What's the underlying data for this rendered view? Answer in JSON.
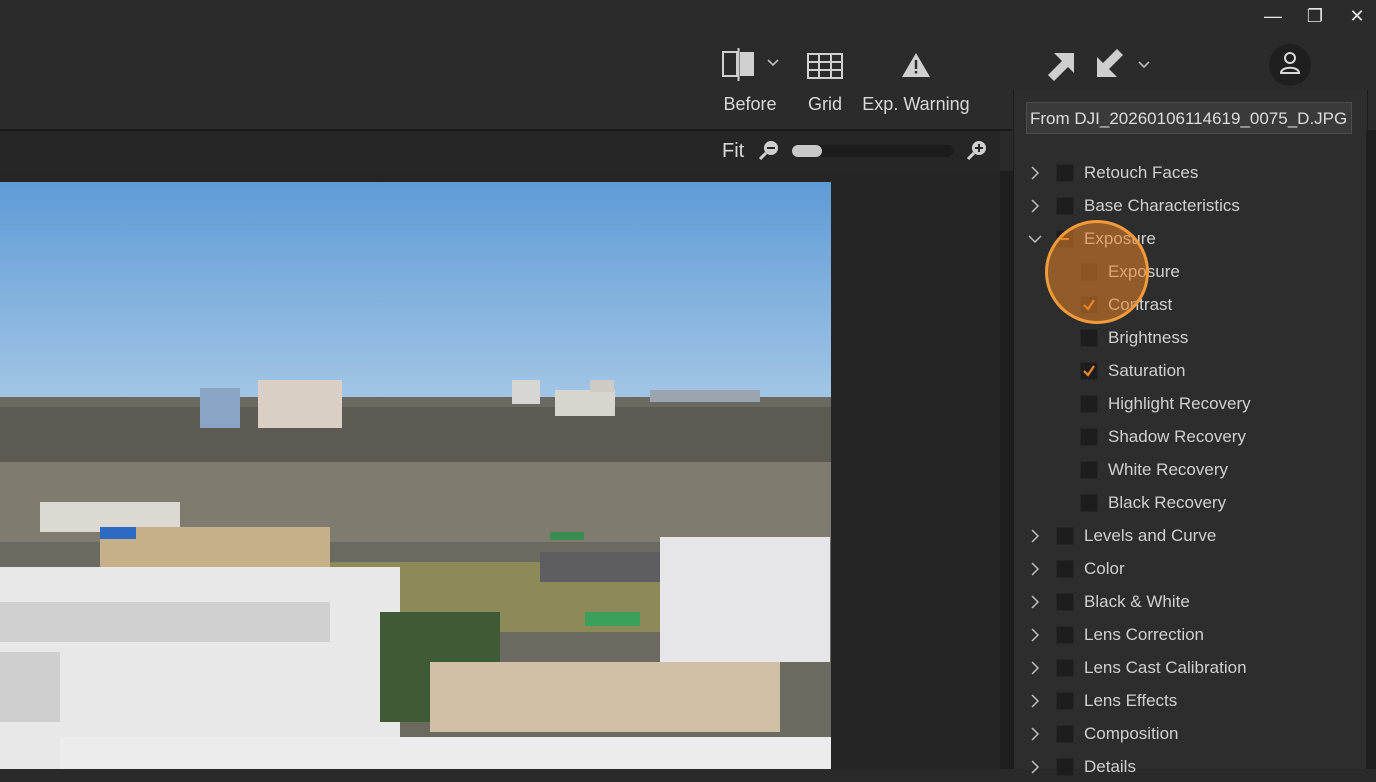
{
  "window_controls": {
    "minimize": "—",
    "maximize": "❐",
    "close": "✕"
  },
  "toolbar": {
    "before_label": "Before",
    "grid_label": "Grid",
    "exp_warning_label": "Exp. Warning"
  },
  "zoom": {
    "fit_label": "Fit",
    "level": 0.18
  },
  "panel": {
    "from_label": "From  DJI_20260106114619_0075_D.JPG",
    "items": [
      {
        "label": "Retouch Faces",
        "expanded": false,
        "checked": false,
        "level": 0
      },
      {
        "label": "Base Characteristics",
        "expanded": false,
        "checked": false,
        "level": 0
      },
      {
        "label": "Exposure",
        "expanded": true,
        "checked": "partial",
        "level": 0
      },
      {
        "label": "Exposure",
        "checked": false,
        "level": 1
      },
      {
        "label": "Contrast",
        "checked": true,
        "level": 1
      },
      {
        "label": "Brightness",
        "checked": false,
        "level": 1
      },
      {
        "label": "Saturation",
        "checked": true,
        "level": 1
      },
      {
        "label": "Highlight Recovery",
        "checked": false,
        "level": 1
      },
      {
        "label": "Shadow Recovery",
        "checked": false,
        "level": 1
      },
      {
        "label": "White Recovery",
        "checked": false,
        "level": 1
      },
      {
        "label": "Black Recovery",
        "checked": false,
        "level": 1
      },
      {
        "label": "Levels and Curve",
        "expanded": false,
        "checked": false,
        "level": 0
      },
      {
        "label": "Color",
        "expanded": false,
        "checked": false,
        "level": 0
      },
      {
        "label": "Black & White",
        "expanded": false,
        "checked": false,
        "level": 0
      },
      {
        "label": "Lens Correction",
        "expanded": false,
        "checked": false,
        "level": 0
      },
      {
        "label": "Lens Cast Calibration",
        "expanded": false,
        "checked": false,
        "level": 0
      },
      {
        "label": "Lens Effects",
        "expanded": false,
        "checked": false,
        "level": 0
      },
      {
        "label": "Composition",
        "expanded": false,
        "checked": false,
        "level": 0
      },
      {
        "label": "Details",
        "expanded": false,
        "checked": false,
        "level": 0
      }
    ]
  },
  "colors": {
    "accent": "#f39a3a",
    "check": "#f0872a",
    "background": "#2a2a2a"
  }
}
